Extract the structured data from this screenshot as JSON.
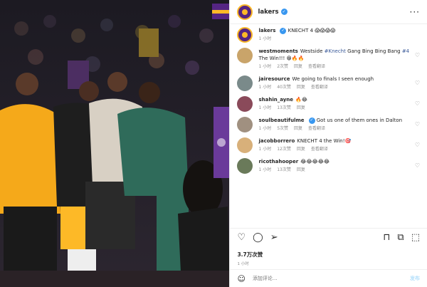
{
  "post": {
    "username": "lakers",
    "caption": {
      "username": "lakers",
      "text": "KNECHT 4 😱😱😱😱",
      "time": "1 小时"
    },
    "more_icon": "more-horizontal-icon"
  },
  "comments": [
    {
      "username": "westmoments",
      "pre": "Westside ",
      "tag1": "#Knecht",
      "mid": " Gang Bing Bing Bang ",
      "tag2": "#4",
      "post": " The Win!!! 😁🔥🔥",
      "time": "1 小时",
      "likes": "2次赞",
      "reply": "回复",
      "translate": "查看翻译",
      "avatar": "#c9a46a"
    },
    {
      "username": "jairesource",
      "text": "We going to finals I seen enough",
      "time": "1 小时",
      "likes": "40次赞",
      "reply": "回复",
      "translate": "查看翻译",
      "avatar": "#7a8a8a"
    },
    {
      "username": "shahin_ayne",
      "text": "🔥😂",
      "time": "1 小时",
      "likes": "13次赞",
      "reply": "回复",
      "avatar": "#8a4a5a"
    },
    {
      "username": "soulbeautifulme",
      "text": "Got us one of them ones in Dalton",
      "time": "1 小时",
      "likes": "5次赞",
      "reply": "回复",
      "translate": "查看翻译",
      "avatar": "#a09080"
    },
    {
      "username": "jacobborrero",
      "text": "KNECHT 4 the Win!🎯",
      "time": "1 小时",
      "likes": "12次赞",
      "reply": "回复",
      "translate": "查看翻译",
      "avatar": "#d8b07a"
    },
    {
      "username": "ricothahooper",
      "text": "😂😂😂😂😂",
      "time": "1 小时",
      "likes": "13次赞",
      "reply": "回复",
      "avatar": "#6a7a5a"
    }
  ],
  "footer": {
    "likes": "3.7万次赞",
    "time": "1 小时",
    "comment_placeholder": "添加评论...",
    "post_label": "发布"
  },
  "colors": {
    "lakers_purple": "#552583",
    "lakers_gold": "#FDB927",
    "link": "#385898"
  }
}
